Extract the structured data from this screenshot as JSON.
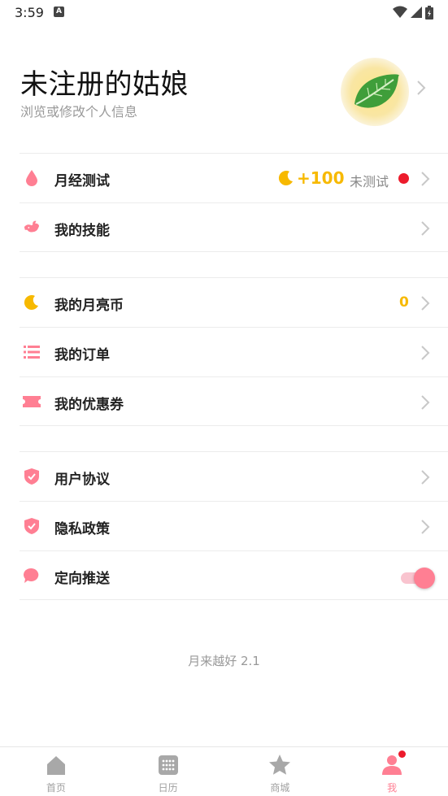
{
  "status_bar": {
    "time": "3:59",
    "notification_letter": "A"
  },
  "profile": {
    "name": "未注册的姑娘",
    "subtitle": "浏览或修改个人信息",
    "avatar_icon": "leaf-icon"
  },
  "menu": {
    "period_test": {
      "label": "月经测试",
      "reward": "+100",
      "status": "未测试"
    },
    "my_skills": {
      "label": "我的技能"
    },
    "moon_coins": {
      "label": "我的月亮币",
      "value": "0"
    },
    "my_orders": {
      "label": "我的订单"
    },
    "my_coupons": {
      "label": "我的优惠券"
    },
    "user_agreement": {
      "label": "用户协议"
    },
    "privacy_policy": {
      "label": "隐私政策"
    },
    "targeted_push": {
      "label": "定向推送",
      "enabled": true
    }
  },
  "version": "月来越好 2.1",
  "tabs": [
    {
      "label": "首页",
      "icon": "home-icon",
      "active": false
    },
    {
      "label": "日历",
      "icon": "calendar-icon",
      "active": false
    },
    {
      "label": "商城",
      "icon": "star-icon",
      "active": false
    },
    {
      "label": "我",
      "icon": "person-icon",
      "active": true,
      "badge": true
    }
  ],
  "colors": {
    "accent": "#ff7f93",
    "gold": "#f7b900",
    "alert": "#ec1b2c",
    "chevron": "#c8c8c8"
  }
}
